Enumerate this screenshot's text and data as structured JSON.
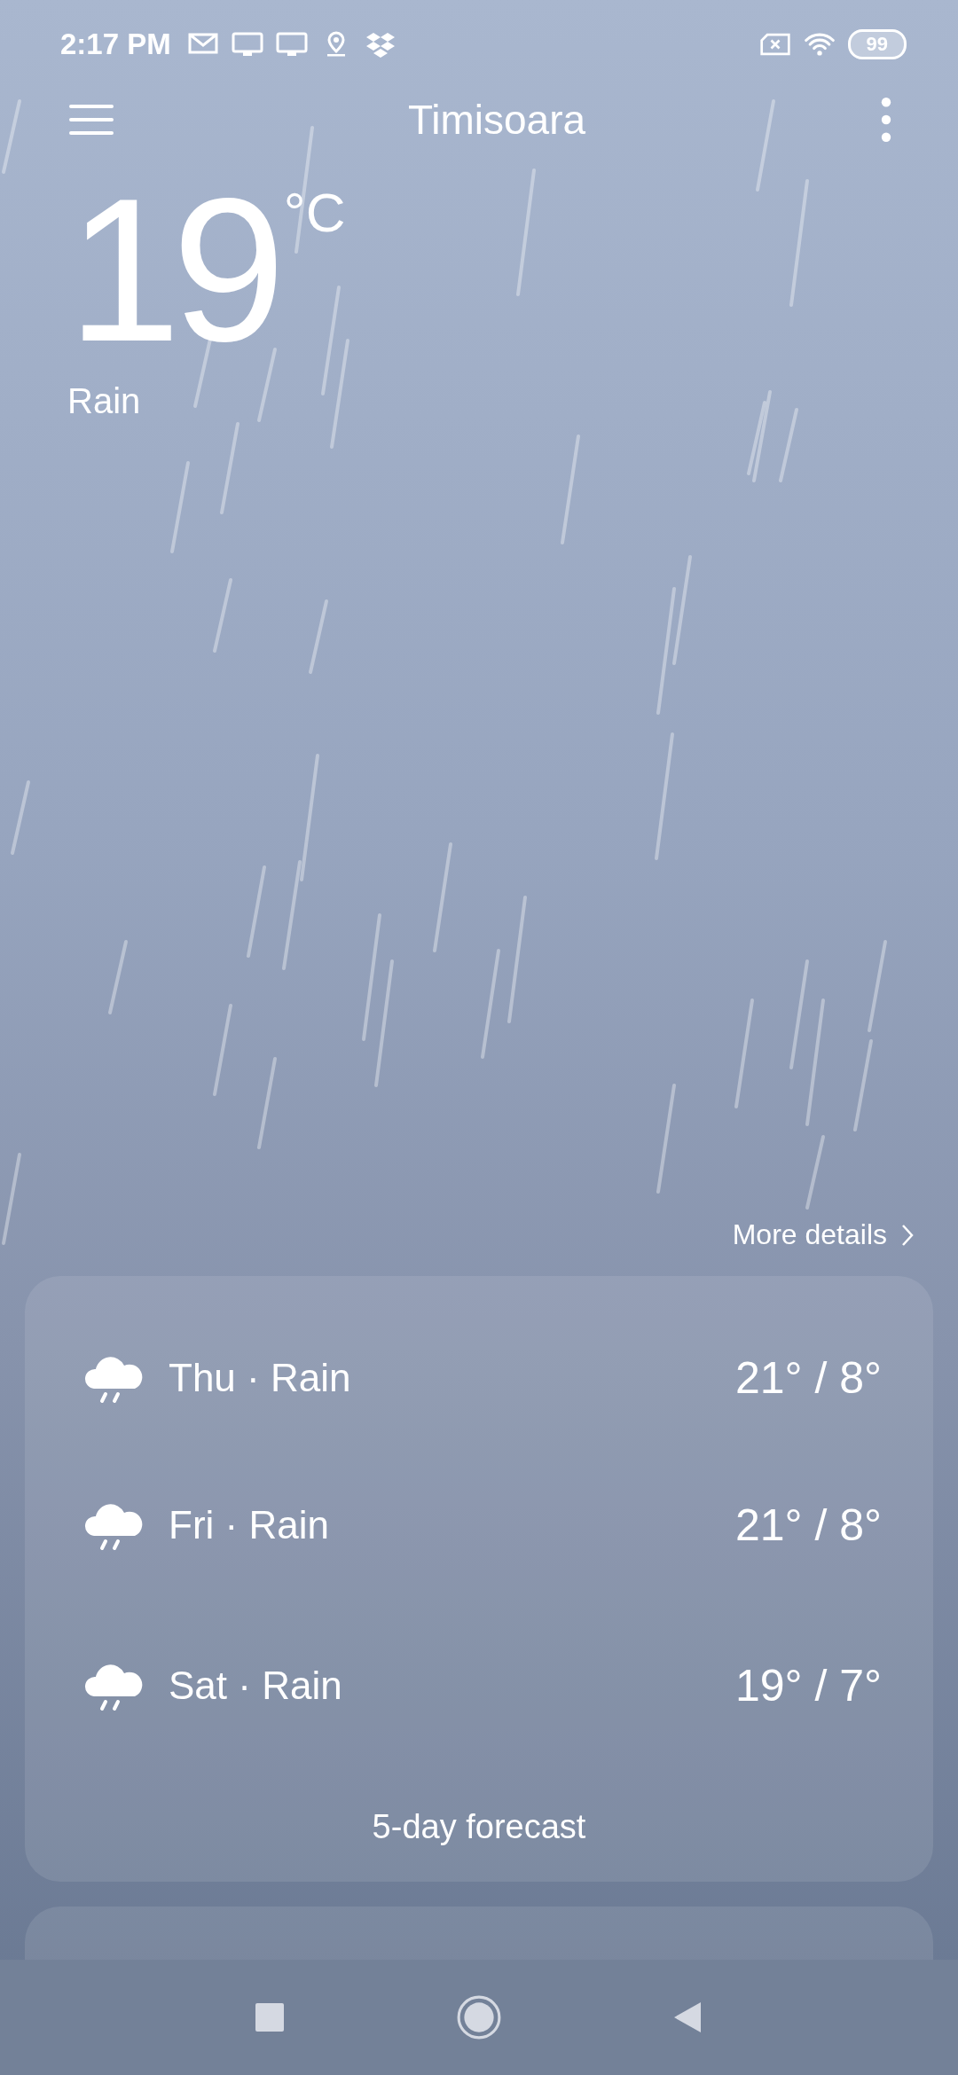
{
  "status_bar": {
    "time": "2:17 PM",
    "battery": "99"
  },
  "header": {
    "title": "Timisoara"
  },
  "current": {
    "temperature": "19",
    "unit": "°C",
    "condition": "Rain"
  },
  "more_details": "More details",
  "forecast": [
    {
      "day": "Thu · Rain",
      "temps": "21° / 8°"
    },
    {
      "day": "Fri · Rain",
      "temps": "21° / 8°"
    },
    {
      "day": "Sat · Rain",
      "temps": "19° / 7°"
    }
  ],
  "forecast_link": "5-day forecast"
}
